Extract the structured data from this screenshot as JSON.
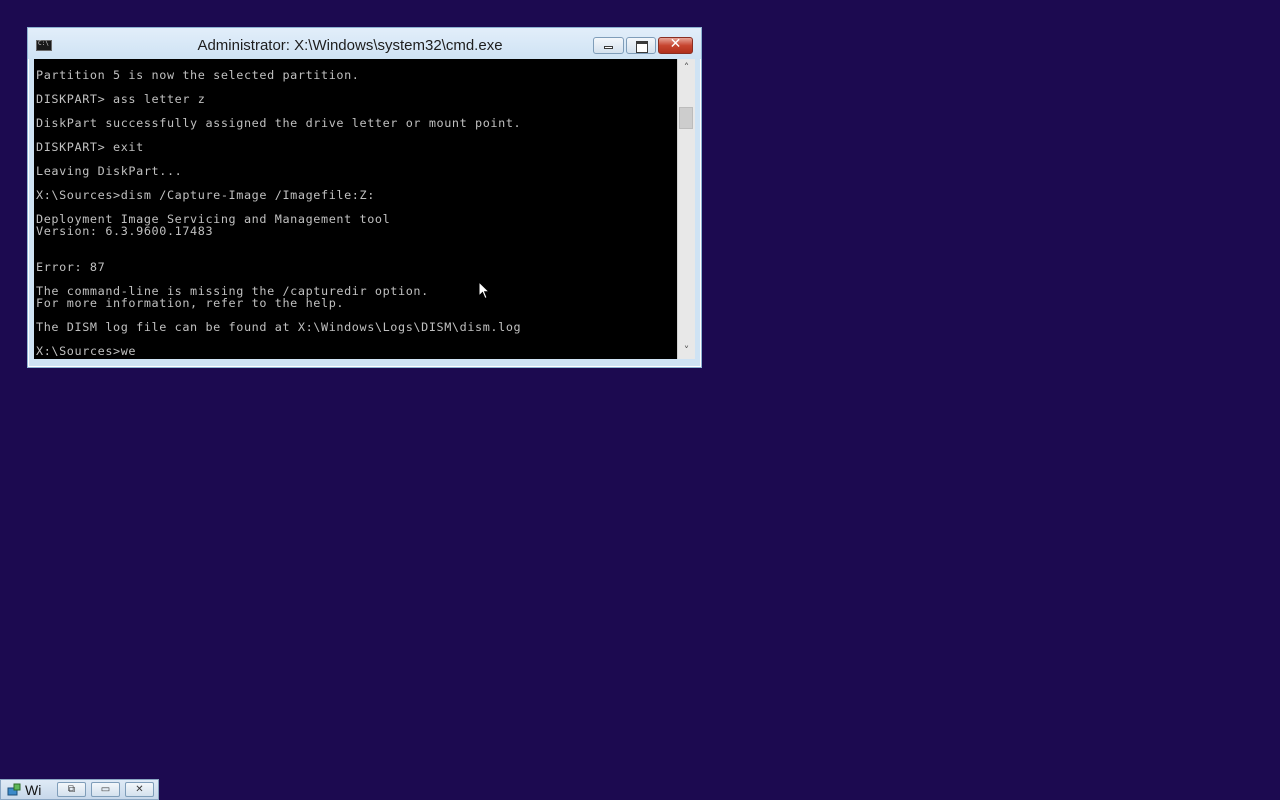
{
  "window": {
    "title": "Administrator: X:\\Windows\\system32\\cmd.exe",
    "buttons": {
      "minimize_icon": "minimize-icon",
      "maximize_icon": "maximize-icon",
      "close_icon": "close-icon",
      "close_glyph": "✕"
    }
  },
  "console": {
    "background": "#000000",
    "foreground": "#c0c0c0",
    "lines": [
      "Partition 5 is now the selected partition.",
      "",
      "DISKPART> ass letter z",
      "",
      "DiskPart successfully assigned the drive letter or mount point.",
      "",
      "DISKPART> exit",
      "",
      "Leaving DiskPart...",
      "",
      "X:\\Sources>dism /Capture-Image /Imagefile:Z:",
      "",
      "Deployment Image Servicing and Management tool",
      "Version: 6.3.9600.17483",
      "",
      "",
      "Error: 87",
      "",
      "The command-line is missing the /capturedir option.",
      "For more information, refer to the help.",
      "",
      "The DISM log file can be found at X:\\Windows\\Logs\\DISM\\dism.log",
      "",
      "X:\\Sources>we"
    ]
  },
  "scrollbar": {
    "up_arrow": "˄",
    "down_arrow": "˅"
  },
  "taskbar": {
    "item_label": "Wi",
    "restore_glyph": "⧉",
    "max_glyph": "▭",
    "close_glyph": "✕"
  },
  "desktop": {
    "background": "#1c0a50"
  }
}
